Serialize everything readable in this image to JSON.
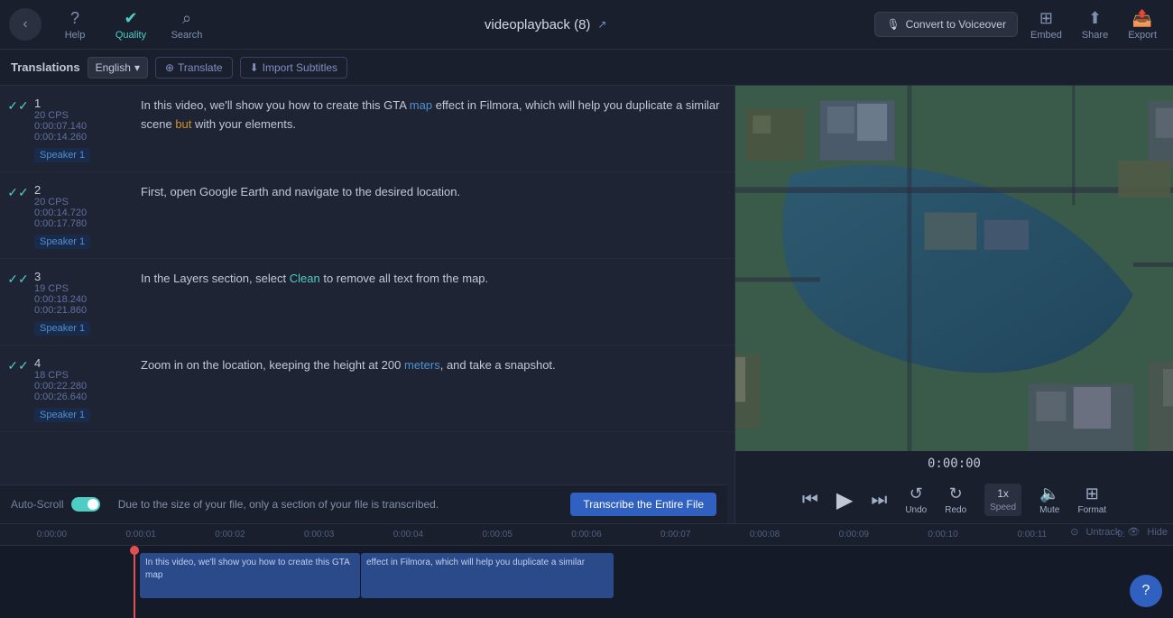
{
  "topbar": {
    "back_label": "←",
    "tools": [
      {
        "id": "help",
        "icon": "?",
        "label": "Help"
      },
      {
        "id": "quality",
        "icon": "✓",
        "label": "Quality"
      },
      {
        "id": "search",
        "icon": "🔍",
        "label": "Search"
      }
    ],
    "title": "videoplayback (8)",
    "ext_link": "↗",
    "voiceover_label": "Convert to Voiceover",
    "embed_label": "Embed",
    "share_label": "Share",
    "export_label": "Export"
  },
  "toolbar": {
    "translations_label": "Translations",
    "language": "English",
    "translate_label": "Translate",
    "import_label": "Import Subtitles"
  },
  "subtitles": [
    {
      "num": "1",
      "cps": "20 CPS",
      "time_start": "0:00:07.140",
      "time_end": "0:00:14.260",
      "speaker": "Speaker 1",
      "text": "In this video, we'll show you how to create this GTA {map} effect in Filmora, which will help you duplicate a similar scene {but} with your elements.",
      "highlights": {
        "map": "blue",
        "but": "orange"
      }
    },
    {
      "num": "2",
      "cps": "20 CPS",
      "time_start": "0:00:14.720",
      "time_end": "0:00:17.780",
      "speaker": "Speaker 1",
      "text": "First, open Google Earth and navigate to the desired location.",
      "highlights": {}
    },
    {
      "num": "3",
      "cps": "19 CPS",
      "time_start": "0:00:18.240",
      "time_end": "0:00:21.860",
      "speaker": "Speaker 1",
      "text": "In the Layers section, select {Clean} to remove all text from the map.",
      "highlights": {
        "Clean": "teal"
      }
    },
    {
      "num": "4",
      "cps": "18 CPS",
      "time_start": "0:00:22.280",
      "time_end": "0:00:26.640",
      "speaker": "Speaker 1",
      "text": "Zoom in on the location, keeping the height at 200 {meters}, and take a snapshot.",
      "highlights": {
        "meters": "blue"
      }
    }
  ],
  "transcribe_banner": {
    "auto_scroll_label": "Auto-Scroll",
    "info_text": "Due to the size of your file, only a section of your file is transcribed.",
    "btn_label": "Transcribe the Entire File"
  },
  "video": {
    "time": "0:00:00",
    "controls": {
      "rewind": "⏮",
      "play": "▶",
      "fastforward": "⏭",
      "undo": "↺",
      "redo": "↻",
      "speed": "1x",
      "mute": "🔇",
      "format": "⛶"
    },
    "control_labels": [
      "Undo",
      "Redo",
      "Speed",
      "Mute",
      "Format"
    ]
  },
  "timeline": {
    "marks": [
      "0:00:00",
      "0:00:01",
      "0:00:02",
      "0:00:03",
      "0:00:04",
      "0:00:05",
      "0:00:06",
      "0:00:07",
      "0:00:08",
      "0:00:09",
      "0:00:10",
      "0:00:11",
      "0:"
    ],
    "track_actions": {
      "untrack": "Untrack",
      "hide": "Hide"
    },
    "block1_text": "In this video, we'll show you how to create this GTA map",
    "block2_text": "effect in Filmora, which will help you duplicate a similar"
  },
  "fab": {
    "icon": "?"
  }
}
